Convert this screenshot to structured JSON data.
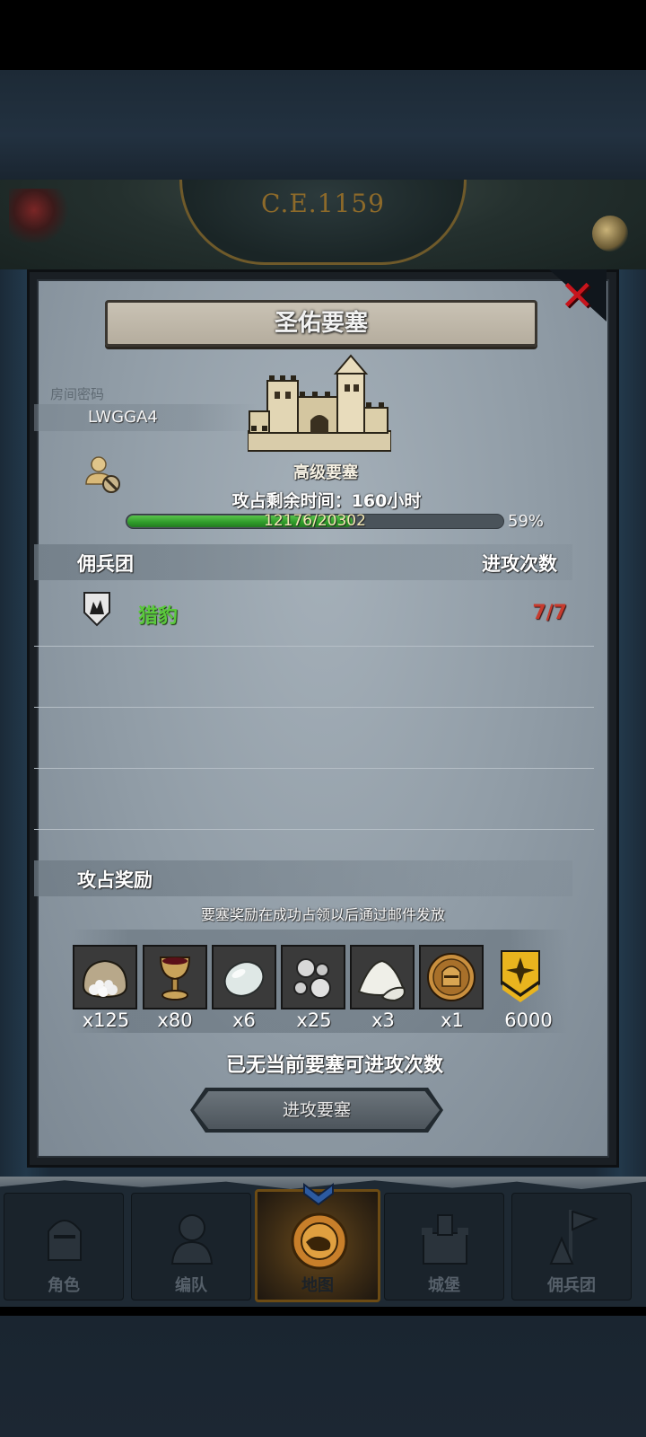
{
  "header": {
    "year_badge": "C.E.1159"
  },
  "modal": {
    "title": "圣佑要塞",
    "room": {
      "label": "房间密码",
      "code": "LWGGA4"
    },
    "fortress": {
      "level_label": "高级要塞",
      "time_left": "攻占剩余时间：160小时",
      "progress": {
        "text": "12176/20302",
        "current": 12176,
        "total": 20302,
        "percent_label": "59%"
      }
    },
    "mercenary_section": {
      "title": "佣兵团",
      "attacks_header": "进攻次数",
      "rows": [
        {
          "name": "猎豹",
          "attacks": "7/7"
        }
      ]
    },
    "reward_section": {
      "title": "攻占奖励",
      "note": "要塞奖励在成功占领以后通过邮件发放",
      "items": [
        {
          "icon": "cotton-sack-icon",
          "count": "x125"
        },
        {
          "icon": "goblet-icon",
          "count": "x80"
        },
        {
          "icon": "stone-egg-icon",
          "count": "x6"
        },
        {
          "icon": "silver-nuggets-icon",
          "count": "x25"
        },
        {
          "icon": "salt-pile-icon",
          "count": "x3"
        },
        {
          "icon": "knight-medal-icon",
          "count": "x1"
        },
        {
          "icon": "honor-rank-icon",
          "count": "6000"
        }
      ]
    },
    "no_attacks_text": "已无当前要塞可进攻次数",
    "attack_button_label": "进攻要塞"
  },
  "bottom_nav": {
    "tabs": [
      {
        "label": "角色",
        "icon": "knight-helmet-icon"
      },
      {
        "label": "编队",
        "icon": "formation-icon"
      },
      {
        "label": "地图",
        "icon": "map-globe-icon",
        "active": true
      },
      {
        "label": "城堡",
        "icon": "castle-icon"
      },
      {
        "label": "佣兵团",
        "icon": "mercenary-icon"
      }
    ]
  },
  "colors": {
    "accent_green": "#5ac93c",
    "attacks_red": "#c63b2e",
    "close_red": "#c8141c",
    "gold": "#8d6a2a"
  }
}
